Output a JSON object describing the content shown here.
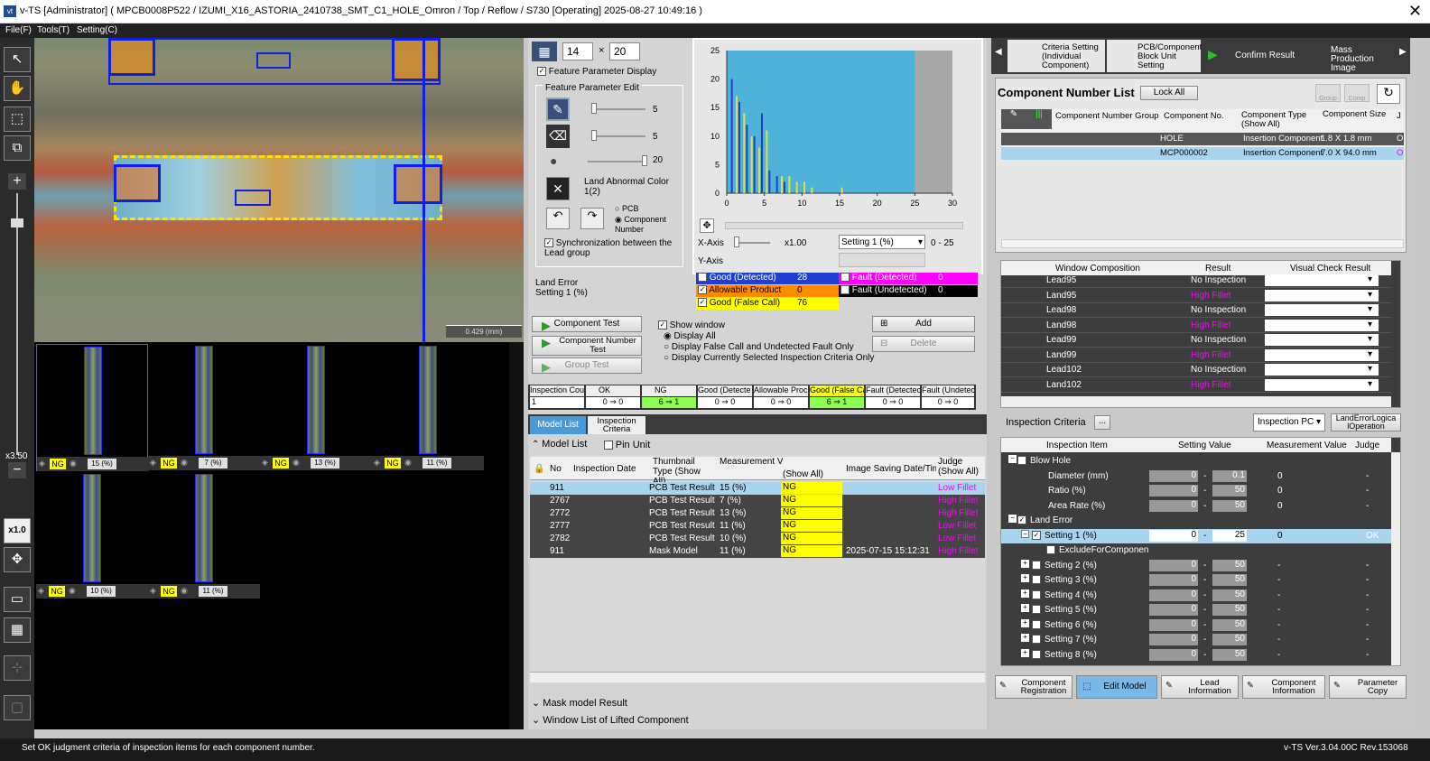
{
  "window": {
    "title": "v-TS [Administrator] ( MPCB0008P522 / IZUMI_X16_ASTORIA_2410738_SMT_C1_HOLE_Omron / Top / Reflow / S730 [Operating] 2025-08-27 10:49:16 )",
    "close": "✕"
  },
  "menu": {
    "file": "File(F)",
    "tools": "Tools(T)",
    "setting": "Setting(C)"
  },
  "left_toolbar": {
    "zoom_label": "x3.50",
    "zoom_reset": "x1.0"
  },
  "camera": {
    "scale_text": "0.429 (mm)"
  },
  "thumbnails": [
    {
      "judge": "NG",
      "value": "15 (%)"
    },
    {
      "judge": "NG",
      "value": "7 (%)"
    },
    {
      "judge": "NG",
      "value": "13 (%)"
    },
    {
      "judge": "NG",
      "value": "11 (%)"
    },
    {
      "judge": "NG",
      "value": "10 (%)"
    },
    {
      "judge": "NG",
      "value": "11 (%)"
    }
  ],
  "feature": {
    "grid_w": "14",
    "grid_x": "×",
    "grid_h": "20",
    "display_label": "Feature Parameter Display",
    "edit_title": "Feature Parameter Edit",
    "slider1_val": "5",
    "slider2_val": "5",
    "slider3_val": "20",
    "land_abnormal": "Land Abnormal Color 1(2)",
    "radio_pcb": "PCB",
    "radio_component": "Component Number",
    "sync_label": "Synchronization between the Lead group",
    "land_error": "Land Error Setting 1 (%)"
  },
  "chart_data": {
    "type": "bar",
    "x_ticks": [
      "0",
      "5",
      "10",
      "15",
      "20",
      "25",
      "30"
    ],
    "y_ticks": [
      "0",
      "5",
      "10",
      "15",
      "20",
      "25"
    ],
    "xlim": [
      0,
      30
    ],
    "ylim": [
      0,
      25
    ],
    "threshold_range": [
      0,
      25
    ],
    "series": [
      {
        "name": "Good (Detected)",
        "color": "#1f3fd0",
        "x": [
          0,
          1,
          2,
          3,
          4,
          5,
          6,
          7
        ],
        "values": [
          20,
          16,
          12,
          10,
          14,
          4,
          3,
          2
        ]
      },
      {
        "name": "Good (False Call)",
        "color": "#e0e040",
        "x": [
          1,
          2,
          3,
          4,
          5,
          7,
          8,
          9,
          10,
          11,
          15
        ],
        "values": [
          17,
          14,
          10,
          8,
          11,
          3,
          3,
          2,
          2,
          1,
          1
        ]
      }
    ]
  },
  "chart_ctrl": {
    "x_axis": "X-Axis",
    "x_mult": "x1.00",
    "select": "Setting 1 (%)",
    "range": "0 - 25",
    "y_axis": "Y-Axis"
  },
  "legend": [
    {
      "label": "Good (Detected)",
      "count": "28",
      "bg": "#1f3fd0",
      "fg": "#ffffff"
    },
    {
      "label": "Fault (Detected)",
      "count": "0",
      "bg": "#ff00ff",
      "fg": "#ffffff"
    },
    {
      "label": "Allowable Product",
      "count": "0",
      "bg": "#ff8c00",
      "fg": "#000000"
    },
    {
      "label": "Fault (Undetected)",
      "count": "0",
      "bg": "#000000",
      "fg": "#ffffff"
    },
    {
      "label": "Good (False Call)",
      "count": "76",
      "bg": "#ffff00",
      "fg": "#000000"
    }
  ],
  "test_buttons": {
    "component_test": "Component Test",
    "component_number_test": "Component Number Test",
    "group_test": "Group Test"
  },
  "show_window": {
    "title": "Show window",
    "opt1": "Display All",
    "opt2": "Display False Call and Undetected Fault Only",
    "opt3": "Display Currently Selected Inspection Criteria Only"
  },
  "add_delete": {
    "add": "Add",
    "delete": "Delete"
  },
  "counts": [
    {
      "label": "Inspection Cou",
      "value": "1"
    },
    {
      "label": "OK",
      "value": "0 ⇒ 0"
    },
    {
      "label": "NG",
      "value": "6 ⇒ 1"
    },
    {
      "label": "Good (Detecte",
      "value": "0 ⇒ 0"
    },
    {
      "label": "Allowable Proc",
      "value": "0 ⇒ 0"
    },
    {
      "label": "Good (False Ca",
      "value": "6 ⇒ 1"
    },
    {
      "label": "Fault (Detectec",
      "value": "0 ⇒ 0"
    },
    {
      "label": "Fault (Undetec",
      "value": "0 ⇒ 0"
    }
  ],
  "tabs": {
    "model_list": "Model List",
    "inspection_criteria": "Inspection Criteria"
  },
  "model_list": {
    "title": "Model List",
    "pin_unit": "Pin Unit",
    "headers": [
      "No",
      "Inspection Date",
      "Thumbnail Type (Show All)",
      "Measurement Va",
      "(Show All)",
      "Image Saving Date/Time",
      "Judge (Show All)"
    ],
    "rows": [
      {
        "no": "911",
        "date": "",
        "type": "PCB Test Result",
        "meas": "15 (%)",
        "judge": "NG",
        "saved": "",
        "result": "Low Fillet"
      },
      {
        "no": "2767",
        "date": "",
        "type": "PCB Test Result",
        "meas": "7 (%)",
        "judge": "NG",
        "saved": "",
        "result": "High Fillet"
      },
      {
        "no": "2772",
        "date": "",
        "type": "PCB Test Result",
        "meas": "13 (%)",
        "judge": "NG",
        "saved": "",
        "result": "High Fillet"
      },
      {
        "no": "2777",
        "date": "",
        "type": "PCB Test Result",
        "meas": "11 (%)",
        "judge": "NG",
        "saved": "",
        "result": "Low Fillet"
      },
      {
        "no": "2782",
        "date": "",
        "type": "PCB Test Result",
        "meas": "10 (%)",
        "judge": "NG",
        "saved": "",
        "result": "Low Fillet"
      },
      {
        "no": "911",
        "date": "",
        "type": "Mask Model",
        "meas": "11 (%)",
        "judge": "NG",
        "saved": "2025-07-15 15:12:31",
        "result": "High Fillet"
      }
    ],
    "mask_result": "Mask model Result",
    "lifted": "Window List of Lifted Component"
  },
  "top_nav": {
    "criteria": "Criteria Setting (Individual Component)",
    "pcb_block": "PCB/Component Block Unit Setting",
    "confirm": "Confirm Result",
    "mass": "Mass Production Image"
  },
  "comp_list": {
    "title": "Component Number List",
    "lock_all": "Lock All",
    "group": "Group",
    "comp": "Comp",
    "headers": [
      "Component Number Group",
      "Component No.",
      "Component Type (Show All)",
      "Component Size",
      "J"
    ],
    "rows": [
      {
        "group": "",
        "no": "HOLE",
        "type": "Insertion Component",
        "size": "1.8 X 1.8 mm",
        "j": "O"
      },
      {
        "group": "",
        "no": "MCP000002",
        "type": "Insertion Component",
        "size": "7.0 X 94.0 mm",
        "j": "O"
      }
    ]
  },
  "window_comp": {
    "headers": [
      "Window Composition",
      "Result",
      "Visual Check Result"
    ],
    "rows": [
      {
        "name": "Lead95",
        "result": "No Inspection",
        "magenta": false
      },
      {
        "name": "Land95",
        "result": "High Fillet",
        "magenta": true
      },
      {
        "name": "Lead98",
        "result": "No Inspection",
        "magenta": false
      },
      {
        "name": "Land98",
        "result": "High Fillet",
        "magenta": true
      },
      {
        "name": "Lead99",
        "result": "No Inspection",
        "magenta": false
      },
      {
        "name": "Land99",
        "result": "High Fillet",
        "magenta": true
      },
      {
        "name": "Lead102",
        "result": "No Inspection",
        "magenta": false
      },
      {
        "name": "Land102",
        "result": "High Fillet",
        "magenta": true
      }
    ]
  },
  "criteria": {
    "title": "Inspection Criteria",
    "dots": "...",
    "pc": "Inspection PC",
    "logical": "LandErrorLogica lOperation",
    "headers": [
      "Inspection Item",
      "Setting Value",
      "Measurement Value",
      "Judge"
    ],
    "rows": [
      {
        "item": "Blow Hole",
        "v1": "",
        "v2": "",
        "meas": "",
        "judge": "",
        "level": 0,
        "group": true
      },
      {
        "item": "Diameter (mm)",
        "v1": "0",
        "v2": "0.1",
        "meas": "0",
        "judge": "-",
        "level": 1
      },
      {
        "item": "Ratio (%)",
        "v1": "0",
        "v2": "50",
        "meas": "0",
        "judge": "-",
        "level": 1
      },
      {
        "item": "Area Rate (%)",
        "v1": "0",
        "v2": "50",
        "meas": "0",
        "judge": "-",
        "level": 1
      },
      {
        "item": "Land Error",
        "v1": "",
        "v2": "",
        "meas": "",
        "judge": "",
        "level": 0,
        "group": true
      },
      {
        "item": "Setting 1 (%)",
        "v1": "0",
        "v2": "25",
        "meas": "0",
        "judge": "OK",
        "level": 1,
        "selected": true
      },
      {
        "item": "ExcludeForComponen",
        "v1": "",
        "v2": "",
        "meas": "",
        "judge": "",
        "level": 2
      },
      {
        "item": "Setting 2 (%)",
        "v1": "0",
        "v2": "50",
        "meas": "-",
        "judge": "-",
        "level": 1
      },
      {
        "item": "Setting 3 (%)",
        "v1": "0",
        "v2": "50",
        "meas": "-",
        "judge": "-",
        "level": 1
      },
      {
        "item": "Setting 4 (%)",
        "v1": "0",
        "v2": "50",
        "meas": "-",
        "judge": "-",
        "level": 1
      },
      {
        "item": "Setting 5 (%)",
        "v1": "0",
        "v2": "50",
        "meas": "-",
        "judge": "-",
        "level": 1
      },
      {
        "item": "Setting 6 (%)",
        "v1": "0",
        "v2": "50",
        "meas": "-",
        "judge": "-",
        "level": 1
      },
      {
        "item": "Setting 7 (%)",
        "v1": "0",
        "v2": "50",
        "meas": "-",
        "judge": "-",
        "level": 1
      },
      {
        "item": "Setting 8 (%)",
        "v1": "0",
        "v2": "50",
        "meas": "-",
        "judge": "-",
        "level": 1
      }
    ]
  },
  "bottom_buttons": {
    "registration": "Component Registration",
    "edit_model": "Edit Model",
    "lead_info": "Lead Information",
    "comp_info": "Component Information",
    "param_copy": "Parameter Copy"
  },
  "status": {
    "message": "Set OK judgment criteria of inspection items for each component number.",
    "version": "v-TS Ver.3.04.00C Rev.153068"
  }
}
